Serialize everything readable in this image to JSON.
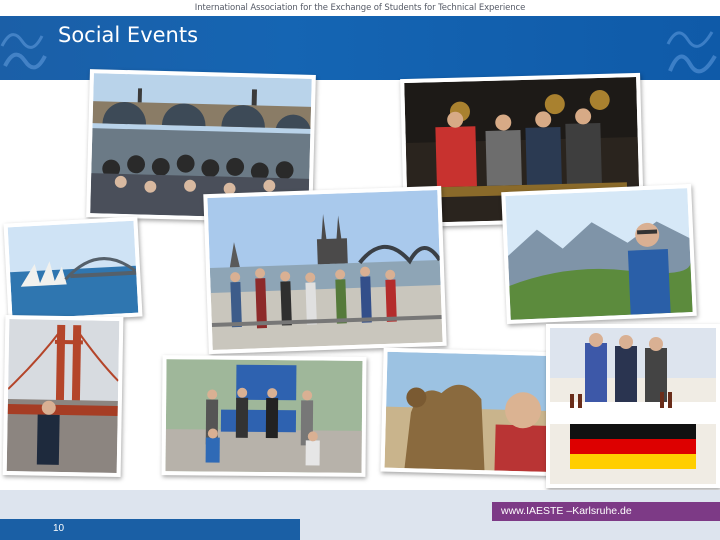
{
  "header": {
    "organization": "International Association for the Exchange of Students for Technical Experience",
    "title": "Social Events"
  },
  "photos": [
    {
      "name": "photo-charles-bridge-crowd"
    },
    {
      "name": "photo-night-statues-group"
    },
    {
      "name": "photo-sydney-opera-house"
    },
    {
      "name": "photo-cologne-cathedral-group"
    },
    {
      "name": "photo-alpine-hiker"
    },
    {
      "name": "photo-golden-gate-bridge"
    },
    {
      "name": "photo-group-with-banners"
    },
    {
      "name": "photo-camel-selfie"
    },
    {
      "name": "photo-germany-food-table"
    }
  ],
  "footer": {
    "url": "www.IAESTE –Karlsruhe.de",
    "page_number": "10"
  },
  "colors": {
    "banner": "#1565b3",
    "footer_bg": "#dde4ee",
    "url_bg": "#7d3a86",
    "page_bar": "#1a5fa5"
  }
}
